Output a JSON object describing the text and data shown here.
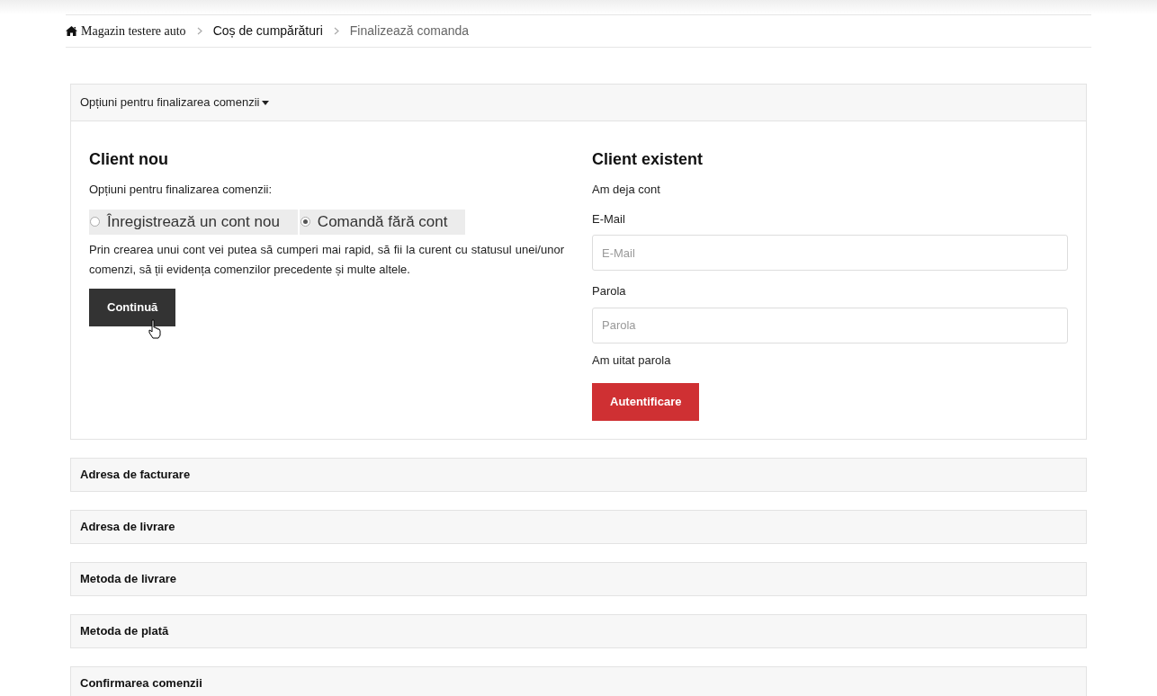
{
  "breadcrumb": [
    {
      "label": "Magazin testere auto",
      "kind": "home"
    },
    {
      "label": "Coș de cumpărături",
      "kind": "link"
    },
    {
      "label": "Finalizează comanda",
      "kind": "current"
    }
  ],
  "checkout_options": {
    "title": "Opțiuni pentru finalizarea comenzii",
    "expanded": true,
    "new_customer": {
      "heading": "Client nou",
      "prompt": "Opțiuni pentru finalizarea comenzii:",
      "options": [
        {
          "label": "Înregistrează un cont nou",
          "selected": false
        },
        {
          "label": "Comandă fără cont",
          "selected": true
        }
      ],
      "description": "Prin crearea unui cont vei putea să cumperi mai rapid, să fii la curent cu statusul unei/unor comenzi, să ții evidența comenzilor precedente și multe altele.",
      "button": "Continuă"
    },
    "returning_customer": {
      "heading": "Client existent",
      "subtitle": "Am deja cont",
      "fields": [
        {
          "label": "E-Mail",
          "placeholder": "E-Mail"
        },
        {
          "label": "Parola",
          "placeholder": "Parola"
        }
      ],
      "forgot_link": "Am uitat parola",
      "button": "Autentificare"
    }
  },
  "sections": [
    {
      "title": "Adresa de facturare"
    },
    {
      "title": "Adresa de livrare"
    },
    {
      "title": "Metoda de livrare"
    },
    {
      "title": "Metoda de plată"
    },
    {
      "title": "Confirmarea comenzii"
    }
  ]
}
